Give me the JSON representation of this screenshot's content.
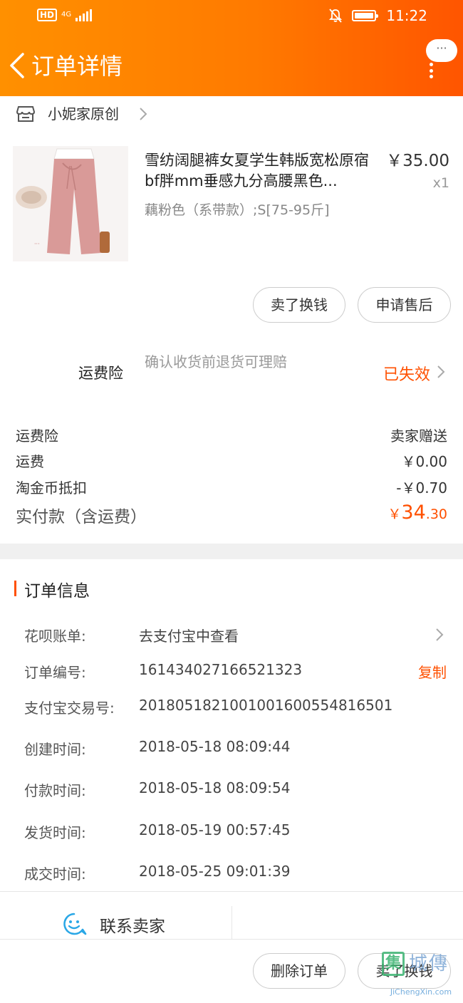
{
  "status_bar": {
    "hd": "HD",
    "network": "4G",
    "time": "11:22"
  },
  "nav": {
    "title": "订单详情",
    "more_label": "···"
  },
  "shop": {
    "name": "小妮家原创"
  },
  "product": {
    "title": "雪纺阔腿裤女夏学生韩版宽松原宿bf胖mm垂感九分高腰黑色...",
    "price": "￥35.00",
    "quantity": "x1",
    "sku": "藕粉色（系带款）;S[75-95斤]"
  },
  "item_actions": {
    "sell_label": "卖了换钱",
    "after_sales_label": "申请售后"
  },
  "insurance": {
    "label": "运费险",
    "description": "确认收货前退货可理赔",
    "status": "已失效"
  },
  "fees": [
    {
      "label": "运费险",
      "value": "卖家赠送"
    },
    {
      "label": "运费",
      "value": "￥0.00"
    },
    {
      "label": "淘金币抵扣",
      "value": "-￥0.70"
    }
  ],
  "paid": {
    "label": "实付款（含运费）",
    "currency": "￥",
    "integer": "34",
    "decimal": ".30"
  },
  "order_info": {
    "title": "订单信息",
    "rows": [
      {
        "key": "花呗账单:",
        "value": "去支付宝中查看"
      },
      {
        "key": "订单编号:",
        "value": "161434027166521323",
        "action": "复制"
      },
      {
        "key": "支付宝交易号:",
        "value": "2018051821001001600554816501"
      },
      {
        "key": "创建时间:",
        "value": "2018-05-18 08:09:44"
      },
      {
        "key": "付款时间:",
        "value": "2018-05-18 08:09:54"
      },
      {
        "key": "发货时间:",
        "value": "2018-05-19 00:57:45"
      },
      {
        "key": "成交时间:",
        "value": "2018-05-25 09:01:39"
      }
    ]
  },
  "contact": {
    "label": "联系卖家"
  },
  "bottom_actions": {
    "delete_label": "删除订单",
    "sell_label": "卖了换钱"
  },
  "watermark": {
    "badge": "集",
    "text": "城傳",
    "url": "JiChengXin.com"
  },
  "colors": {
    "accent": "#ff5000",
    "header_start": "#ff9000",
    "header_end": "#ff5500"
  }
}
